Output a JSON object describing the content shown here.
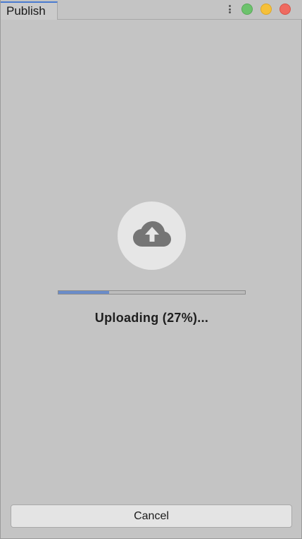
{
  "tab": {
    "title": "Publish"
  },
  "window_controls": {
    "menu_icon": "kebab-menu-icon",
    "colors": {
      "green": "#6cc26c",
      "yellow": "#f5c03a",
      "red": "#ef6a60"
    }
  },
  "upload": {
    "icon": "cloud-upload-icon",
    "progress_percent": 27,
    "status": "Uploading (27%)...",
    "progress_color": "#6a8cc9"
  },
  "actions": {
    "cancel_label": "Cancel"
  }
}
